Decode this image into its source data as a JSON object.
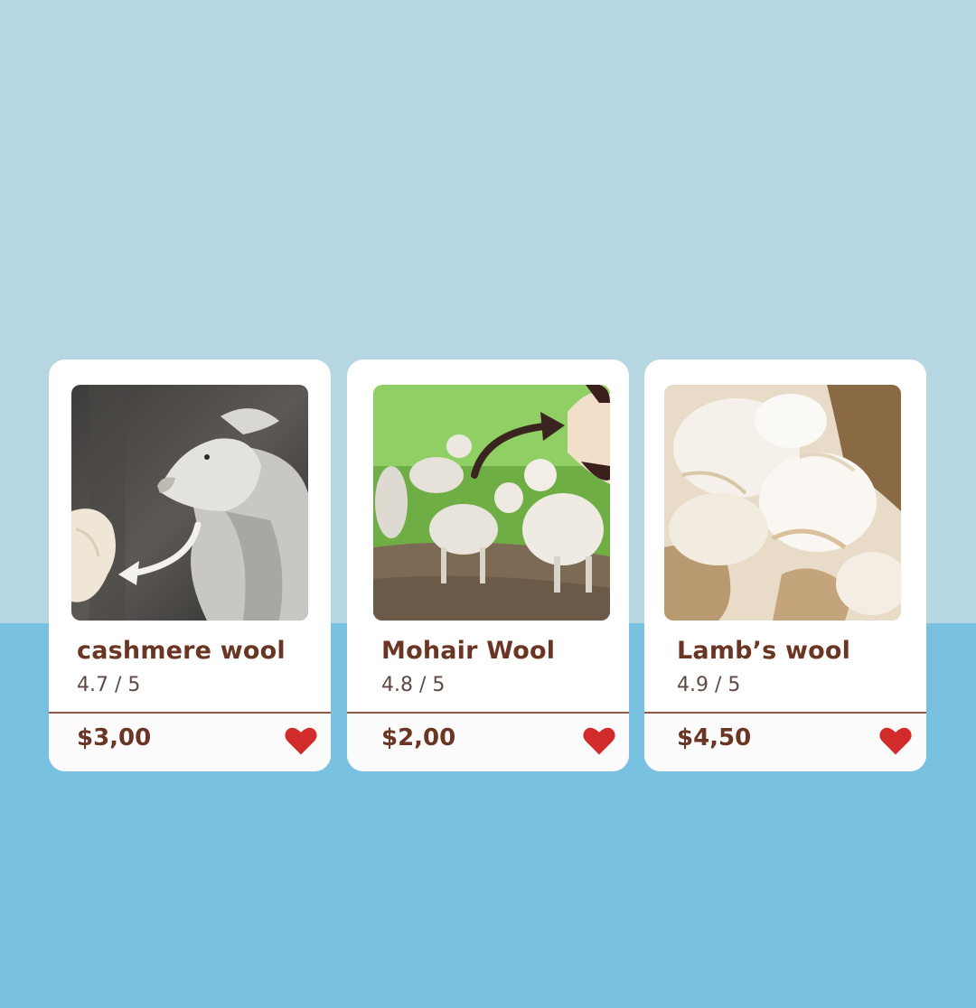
{
  "colors": {
    "background_top": "#b6d6e2",
    "background_bottom": "#78c1e1",
    "card": "#ffffff",
    "text_brown": "#6b3524",
    "heart_red": "#d12b2b"
  },
  "products": [
    {
      "name": "cashmere wool",
      "rating": "4.7 / 5",
      "price": "$3,00",
      "image_icon": "goat-with-fiber-image"
    },
    {
      "name": "Mohair Wool",
      "rating": "4.8 / 5",
      "price": "$2,00",
      "image_icon": "angora-goats-image"
    },
    {
      "name": "Lamb’s wool",
      "rating": "4.9 / 5",
      "price": "$4,50",
      "image_icon": "raw-wool-image"
    }
  ]
}
